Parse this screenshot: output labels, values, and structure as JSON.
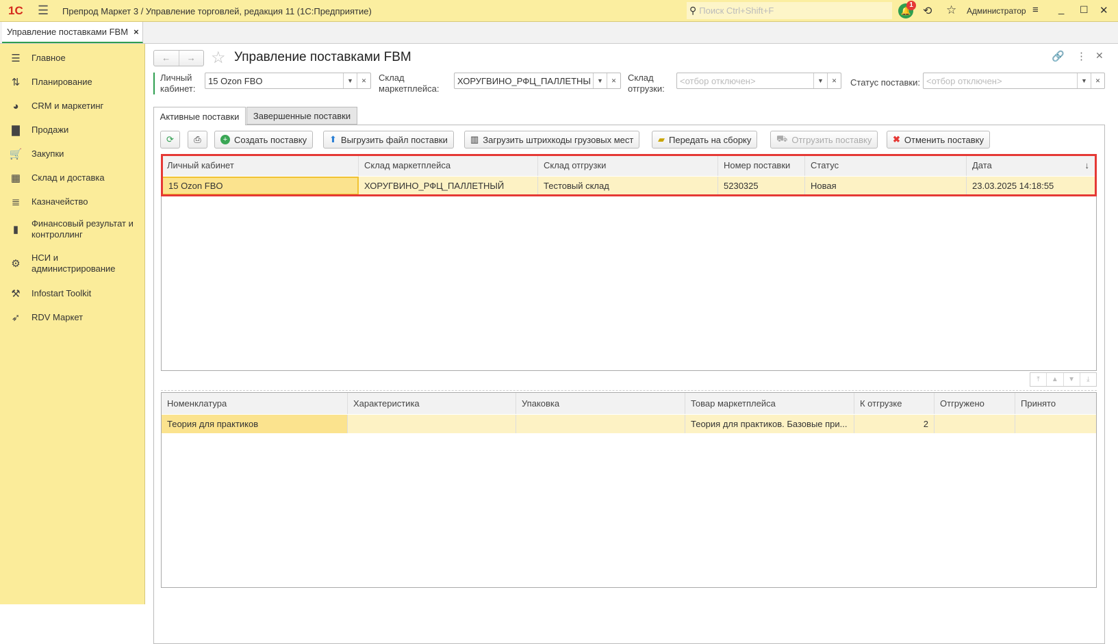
{
  "window": {
    "title": "Препрод Маркет 3 / Управление торговлей, редакция 11  (1С:Предприятие)",
    "search_placeholder": "Поиск Ctrl+Shift+F",
    "notification_count": "1",
    "user": "Администратор",
    "logo": "1С"
  },
  "open_tab": {
    "label": "Управление поставками FBM",
    "close": "×"
  },
  "sidebar": {
    "items": [
      {
        "label": "Главное",
        "icon": "menu-icon"
      },
      {
        "label": "Планирование",
        "icon": "planning-icon"
      },
      {
        "label": "CRM и маркетинг",
        "icon": "pie-icon"
      },
      {
        "label": "Продажи",
        "icon": "bag-icon"
      },
      {
        "label": "Закупки",
        "icon": "cart-icon"
      },
      {
        "label": "Склад и доставка",
        "icon": "warehouse-icon"
      },
      {
        "label": "Казначейство",
        "icon": "coins-icon"
      },
      {
        "label": "Финансовый результат и контроллинг",
        "icon": "bar-chart-icon"
      },
      {
        "label": "НСИ и администрирование",
        "icon": "gear-icon"
      },
      {
        "label": "Infostart Toolkit",
        "icon": "tools-icon"
      },
      {
        "label": "RDV Маркет",
        "icon": "rocket-icon"
      }
    ]
  },
  "form": {
    "title": "Управление поставками FBM",
    "filters": {
      "cabinet": {
        "label": "Личный кабинет:",
        "value": "15 Ozon FBO"
      },
      "mp_warehouse": {
        "label": "Склад маркетплейса:",
        "value": "ХОРУГВИНО_РФЦ_ПАЛЛЕТНЫ"
      },
      "ship_warehouse": {
        "label": "Склад отгрузки:",
        "placeholder": "<отбор отключен>"
      },
      "status": {
        "label": "Статус поставки:",
        "placeholder": "<отбор отключен>"
      }
    },
    "tabs": [
      {
        "label": "Активные поставки",
        "active": true
      },
      {
        "label": "Завершенные поставки",
        "active": false
      }
    ],
    "toolbar": {
      "create": "Создать поставку",
      "export": "Выгрузить файл поставки",
      "barcodes": "Загрузить штрихкоды грузовых мест",
      "assemble": "Передать на сборку",
      "ship": "Отгрузить поставку",
      "cancel": "Отменить поставку"
    },
    "supplies": {
      "columns": [
        "Личный кабинет",
        "Склад маркетплейса",
        "Склад отгрузки",
        "Номер поставки",
        "Статус",
        "Дата"
      ],
      "sort_indicator": "↓",
      "rows": [
        [
          "15 Ozon FBO",
          "ХОРУГВИНО_РФЦ_ПАЛЛЕТНЫЙ",
          "Тестовый склад",
          "5230325",
          "Новая",
          "23.03.2025 14:18:55"
        ]
      ]
    },
    "goods": {
      "columns": [
        "Номенклатура",
        "Характеристика",
        "Упаковка",
        "Товар маркетплейса",
        "К отгрузке",
        "Отгружено",
        "Принято"
      ],
      "rows": [
        [
          "Теория для практиков",
          "",
          "",
          "Теория для практиков. Базовые при...",
          "2",
          "",
          ""
        ]
      ]
    }
  },
  "colors": {
    "accent": "#2e9e4f",
    "highlight_border": "#e53935",
    "row": "#fdf2c4",
    "current_cell": "#fbe38e",
    "sidebar": "#fbec9a"
  }
}
